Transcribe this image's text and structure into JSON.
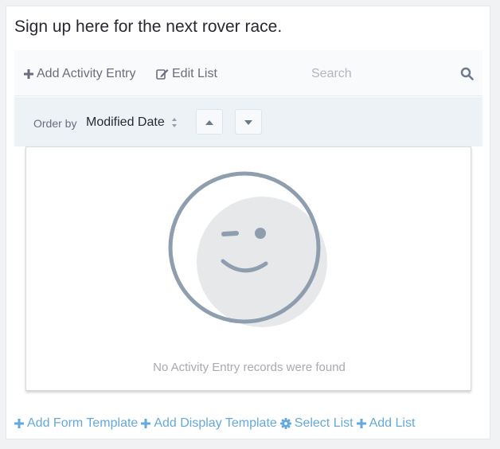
{
  "portlet": {
    "title": "Sign up here for the next rover race."
  },
  "toolbar": {
    "add_entry_label": "Add Activity Entry",
    "add_entry_icon": "plus-icon",
    "edit_list_label": "Edit List",
    "edit_list_icon": "edit-icon",
    "search_placeholder": "Search",
    "search_icon": "search-icon"
  },
  "order": {
    "label": "Order by",
    "selected": "Modified Date",
    "asc_icon": "caret-up-icon",
    "desc_icon": "caret-down-icon"
  },
  "empty_state": {
    "message": "No Activity Entry records were found",
    "icon": "winking-face-icon"
  },
  "footer": {
    "links": [
      {
        "label": "Add Form Template",
        "icon": "plus-icon"
      },
      {
        "label": "Add Display Template",
        "icon": "plus-icon"
      },
      {
        "label": "Select List",
        "icon": "gear-icon"
      },
      {
        "label": "Add List",
        "icon": "plus-icon"
      }
    ]
  },
  "colors": {
    "link_blue": "#65a9dc",
    "muted_text": "#6b6c7e",
    "placeholder": "#b2b5bd",
    "face_stroke": "#8f9eae",
    "face_fill": "#e6e8ea"
  }
}
